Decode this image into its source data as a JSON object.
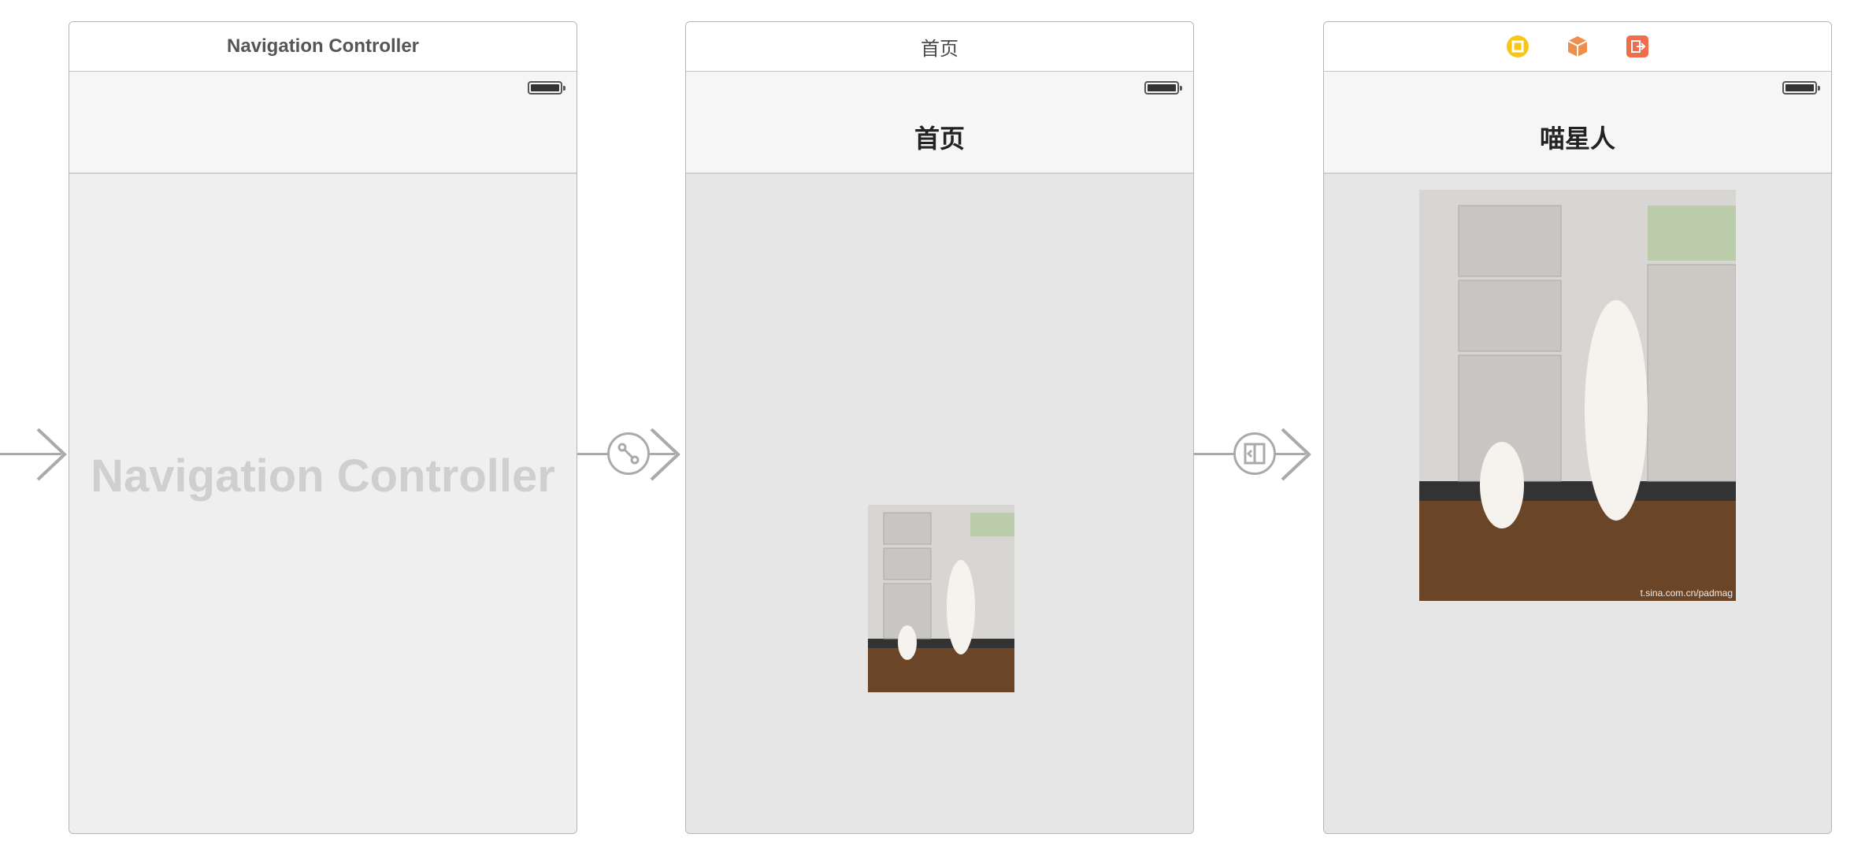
{
  "scenes": [
    {
      "header_title": "Navigation Controller",
      "watermark": "Navigation Controller"
    },
    {
      "header_title": "首页",
      "nav_title": "首页"
    },
    {
      "header_icons": [
        "view-controller-icon",
        "first-responder-icon",
        "exit-icon"
      ],
      "nav_title": "喵星人",
      "photo_caption": "t.sina.com.cn/padmag"
    }
  ],
  "segues": [
    "entry-arrow",
    "root-view-controller-segue",
    "push-segue"
  ]
}
